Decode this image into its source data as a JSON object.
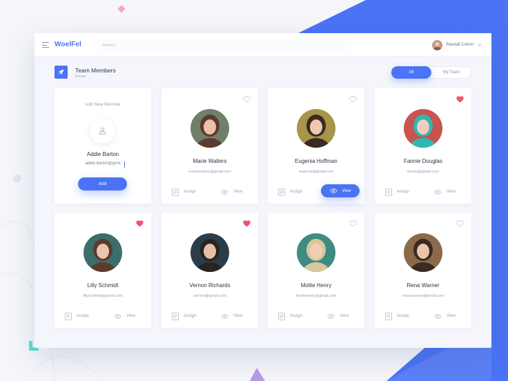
{
  "app": {
    "logo": "WoelFel",
    "search_placeholder": "Search...",
    "user_name": "Randall Cohen"
  },
  "section": {
    "title": "Team Members",
    "subtitle": "Rocket"
  },
  "filter": {
    "options": [
      "All",
      "My Team"
    ],
    "selected": "All"
  },
  "add_member": {
    "title": "Add New Member",
    "name": "Addie Barton",
    "email_value": "addie.barton@gma",
    "button": "Add"
  },
  "actions": {
    "assign": "Assign",
    "view": "View"
  },
  "members": [
    {
      "name": "Marie Walters",
      "email": "mariewalters@gmail.com",
      "favorite": false,
      "view_active": false
    },
    {
      "name": "Eugenia Hoffman",
      "email": "eugenia@gmail.com",
      "favorite": false,
      "view_active": true
    },
    {
      "name": "Fannie Douglas",
      "email": "fannie@gmail.com",
      "favorite": true,
      "view_active": false
    },
    {
      "name": "Lilly Schmidt",
      "email": "lillyschmidt@gmail.com",
      "favorite": true,
      "view_active": false
    },
    {
      "name": "Vernon Richards",
      "email": "vernon@gmail.com",
      "favorite": true,
      "view_active": false
    },
    {
      "name": "Mollie Henry",
      "email": "molliehenry@gmail.com",
      "favorite": false,
      "view_active": false
    },
    {
      "name": "Rena Warner",
      "email": "rena.warner@gmail.com",
      "favorite": false,
      "view_active": false
    }
  ],
  "colors": {
    "accent": "#4a74f5",
    "heart_active": "#f4506e",
    "heart_inactive": "#c5cad8"
  }
}
